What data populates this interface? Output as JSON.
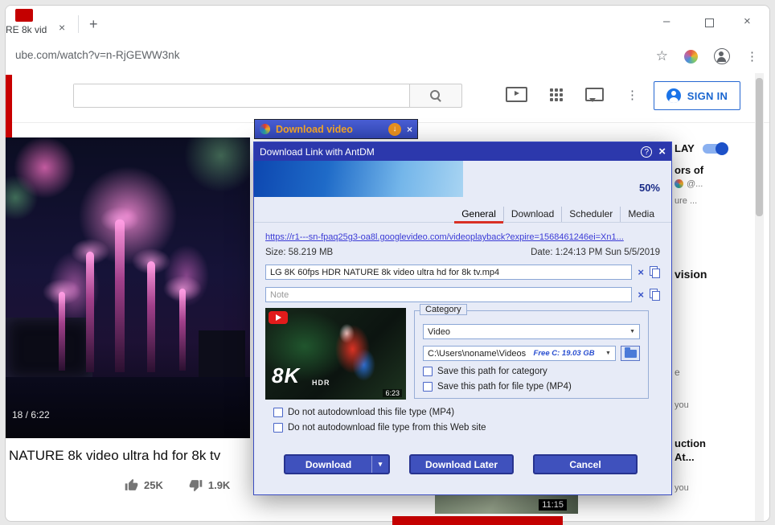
{
  "icons": {
    "close": "×",
    "clear": "×",
    "plus": "+",
    "minimize": "–",
    "dots": "⋮",
    "star": "☆",
    "combo_arrow": "▼",
    "caret": "▾",
    "down_arrow": "↓",
    "help": "?"
  },
  "browser": {
    "tab_title": "RE 8k vid",
    "url": "ube.com/watch?v=n-RjGEWW3nk"
  },
  "youtube": {
    "signin_label": "SIGN IN",
    "video_title": "NATURE 8k video ultra hd for 8k tv",
    "likes": "25K",
    "dislikes": "1.9K",
    "player_time": "18 / 6:22",
    "related_time": "11:15",
    "sidebar": [
      "LAY",
      "ors of",
      "@...",
      "ure ...",
      "vision",
      "e",
      "you",
      "uction",
      "At...",
      "you"
    ]
  },
  "badge": {
    "label": "Download video"
  },
  "dialog": {
    "title": "Download Link with AntDM",
    "progress_label": "50%",
    "tabs": [
      "General",
      "Download",
      "Scheduler",
      "Media"
    ],
    "url": "https://r1---sn-fpaq25g3-oa8l.googlevideo.com/videoplayback?expire=1568461246ei=Xn1...",
    "size_label": "Size:",
    "size_value": "58.219 MB",
    "date_label": "Date:",
    "date_value": "1:24:13 PM Sun 5/5/2019",
    "filename": "LG 8K 60fps HDR NATURE 8k video ultra hd for 8k tv.mp4",
    "note_placeholder": "Note",
    "thumb": {
      "res": "8K",
      "hdr": "HDR",
      "time": "6:23"
    },
    "category": {
      "label": "Category",
      "type_value": "Video",
      "path_value": "C:\\Users\\noname\\Videos",
      "free_space": "Free C: 19.03 GB",
      "cb_category": "Save this path for category",
      "cb_filetype": "Save this path for file type (MP4)"
    },
    "cb_no_auto_type": "Do not autodownload this file type (MP4)",
    "cb_no_auto_site": "Do not autodownload file type from this Web site",
    "buttons": {
      "download": "Download",
      "later": "Download Later",
      "cancel": "Cancel"
    }
  }
}
